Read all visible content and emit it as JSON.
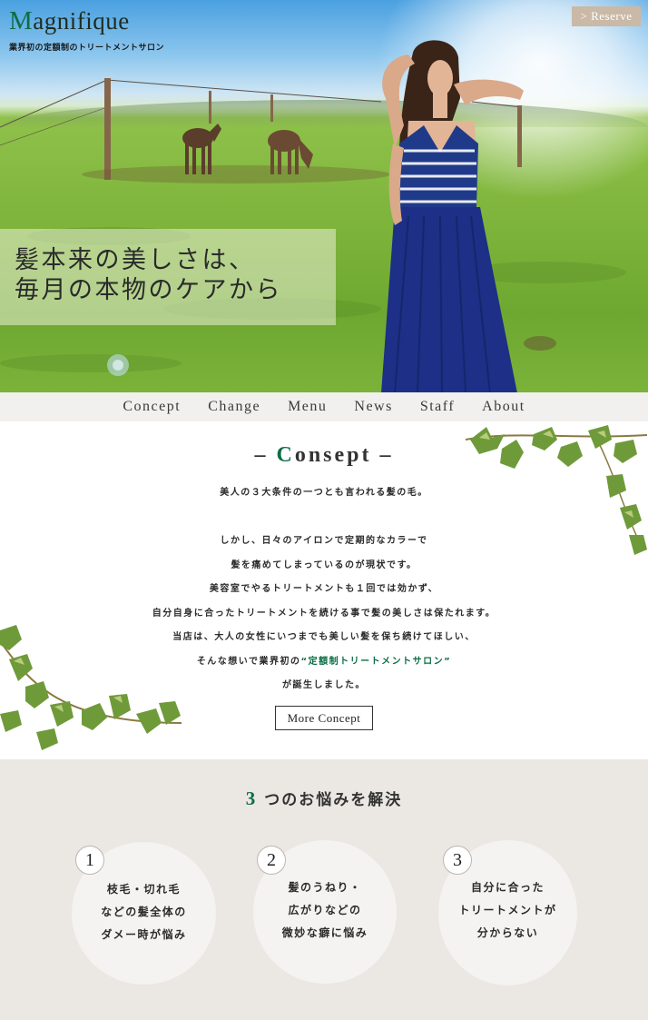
{
  "brand": {
    "logo_initial": "M",
    "logo_rest": "agnifique",
    "tagline": "業界初の定額制のトリートメントサロン"
  },
  "header": {
    "reserve_label": "> Reserve"
  },
  "hero": {
    "copy_line1": "髪本来の美しさは、",
    "copy_line2": "毎月の本物のケアから"
  },
  "nav": {
    "items": [
      "Concept",
      "Change",
      "Menu",
      "News",
      "Staff",
      "About"
    ]
  },
  "concept": {
    "title_prefix": "– ",
    "title_initial": "C",
    "title_rest": "onsept",
    "title_suffix": " –",
    "lines": [
      "美人の３大条件の一つとも言われる髪の毛。",
      "しかし、日々のアイロンで定期的なカラーで",
      "髪を痛めてしまっているのが現状です。",
      "美容室でやるトリートメントも１回では効かず、",
      "自分自身に合ったトリートメントを続ける事で髪の美しさは保たれます。",
      "当店は、大人の女性にいつまでも美しい髪を保ち続けてほしい、"
    ],
    "line_last_prefix": "そんな想いで業界初の",
    "line_last_highlight": "“定額制トリートメントサロン”",
    "line_final": "が誕生しました。",
    "more_label": "More Concept"
  },
  "worries": {
    "title_number": "3",
    "title_rest": "つのお悩みを解決",
    "items": [
      {
        "number": "1",
        "line1": "枝毛・切れ毛",
        "line2": "などの髪全体の",
        "line3": "ダメー時が悩み"
      },
      {
        "number": "2",
        "line1": "髪のうねり・",
        "line2": "広がりなどの",
        "line3": "微妙な癖に悩み"
      },
      {
        "number": "3",
        "line1": "自分に合った",
        "line2": "トリートメントが",
        "line3": "分からない"
      }
    ]
  },
  "colors": {
    "accent_green": "#0c6e46",
    "reserve_bg": "#c9b9a6",
    "nav_bg": "#f1f0ee",
    "worries_bg": "#ebe7e3"
  }
}
